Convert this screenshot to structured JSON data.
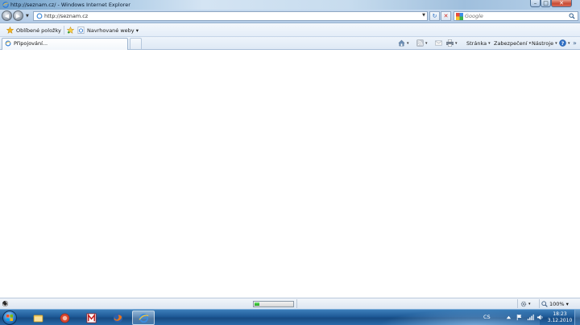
{
  "window": {
    "title": "http://seznam.cz/ - Windows Internet Explorer",
    "minimize_glyph": "–",
    "maximize_glyph": "□",
    "close_glyph": "✕"
  },
  "address": {
    "url": "http://seznam.cz",
    "back_glyph": "◀",
    "forward_glyph": "▶",
    "refresh_glyph": "↻",
    "stop_glyph": "✕"
  },
  "search": {
    "placeholder": "Google"
  },
  "favorites_bar": {
    "favorites_label": "Oblíbené položky",
    "suggested_label": "Navrhované weby ▾"
  },
  "tabs": [
    {
      "label": "Připojování..."
    }
  ],
  "command_bar": {
    "page_label": "Stránka",
    "security_label": "Zabezpečení",
    "tools_label": "Nástroje",
    "arrow": "▾"
  },
  "status_bar": {
    "loading_progress": 0.12,
    "zoom_label": "100%",
    "zoom_arrow": "▾"
  },
  "taskbar": {
    "language": "CS",
    "time": "18:23",
    "date": "3.12.2010"
  },
  "colors": {
    "loading_green": "#1aa01a",
    "taskbar_blue": "#1e5a97",
    "close_red": "#c84b33"
  }
}
